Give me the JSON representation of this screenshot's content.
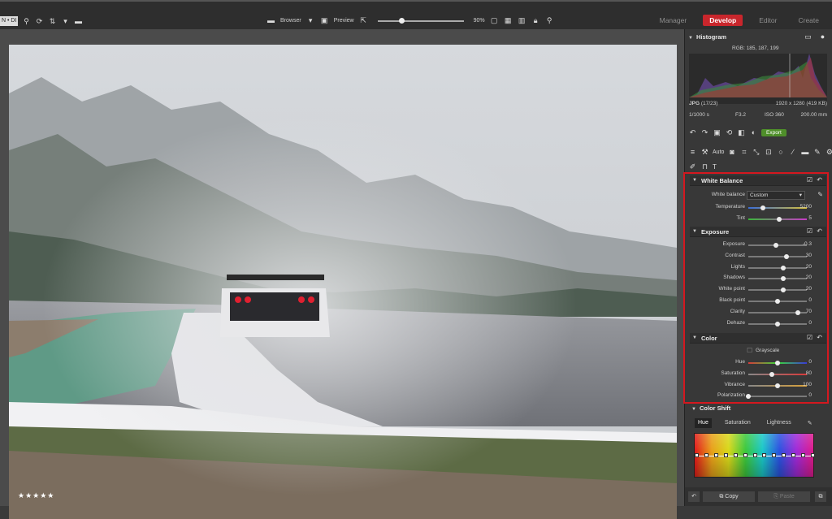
{
  "toolbar": {
    "filter_text": "N • DI",
    "browser_label": "Browser",
    "preview_label": "Preview",
    "zoom_value": "90%",
    "zoom_level": 0.25
  },
  "tabs": [
    {
      "label": "Manager"
    },
    {
      "label": "Develop",
      "active": true
    },
    {
      "label": "Editor"
    },
    {
      "label": "Create"
    }
  ],
  "rating": "★★★★★",
  "histogram": {
    "title": "Histogram",
    "rgb": "RGB: 185, 187, 199"
  },
  "fileinfo": {
    "format": "JPG",
    "index": "(17/23)",
    "dimensions": "1920 x 1280 (419 KB)",
    "shutter": "1/1000 s",
    "aperture": "F3.2",
    "iso": "ISO 360",
    "focal": "200.00 mm"
  },
  "tools": {
    "export_label": "Export",
    "auto_label": "Auto",
    "text_tool": "T"
  },
  "white_balance": {
    "title": "White Balance",
    "wb_label": "White balance",
    "wb_value": "Custom",
    "rows": [
      {
        "label": "Temperature",
        "value": "5200",
        "pos": 0.25
      },
      {
        "label": "Tint",
        "value": "5",
        "pos": 0.53
      }
    ]
  },
  "exposure": {
    "title": "Exposure",
    "rows": [
      {
        "label": "Exposure",
        "value": "-0.3",
        "pos": 0.47
      },
      {
        "label": "Contrast",
        "value": "30",
        "pos": 0.65
      },
      {
        "label": "Lights",
        "value": "20",
        "pos": 0.6
      },
      {
        "label": "Shadows",
        "value": "20",
        "pos": 0.6
      },
      {
        "label": "White point",
        "value": "20",
        "pos": 0.6
      },
      {
        "label": "Black point",
        "value": "0",
        "pos": 0.5
      },
      {
        "label": "Clarity",
        "value": "70",
        "pos": 0.85
      },
      {
        "label": "Dehaze",
        "value": "0",
        "pos": 0.5
      }
    ]
  },
  "color": {
    "title": "Color",
    "grayscale_label": "Grayscale",
    "rows": [
      {
        "label": "Hue",
        "value": "0",
        "pos": 0.5
      },
      {
        "label": "Saturation",
        "value": "80",
        "pos": 0.4
      },
      {
        "label": "Vibrance",
        "value": "100",
        "pos": 0.5
      },
      {
        "label": "Polarization",
        "value": "0",
        "pos": 0.0
      }
    ]
  },
  "color_shift": {
    "title": "Color Shift",
    "tabs": [
      "Hue",
      "Saturation",
      "Lightness"
    ]
  },
  "bottom": {
    "copy_label": "Copy",
    "paste_label": "Paste"
  },
  "colors": {
    "accent": "#c9262c",
    "highlight_box": "#d4181f",
    "export_green": "#4f8f2a"
  }
}
